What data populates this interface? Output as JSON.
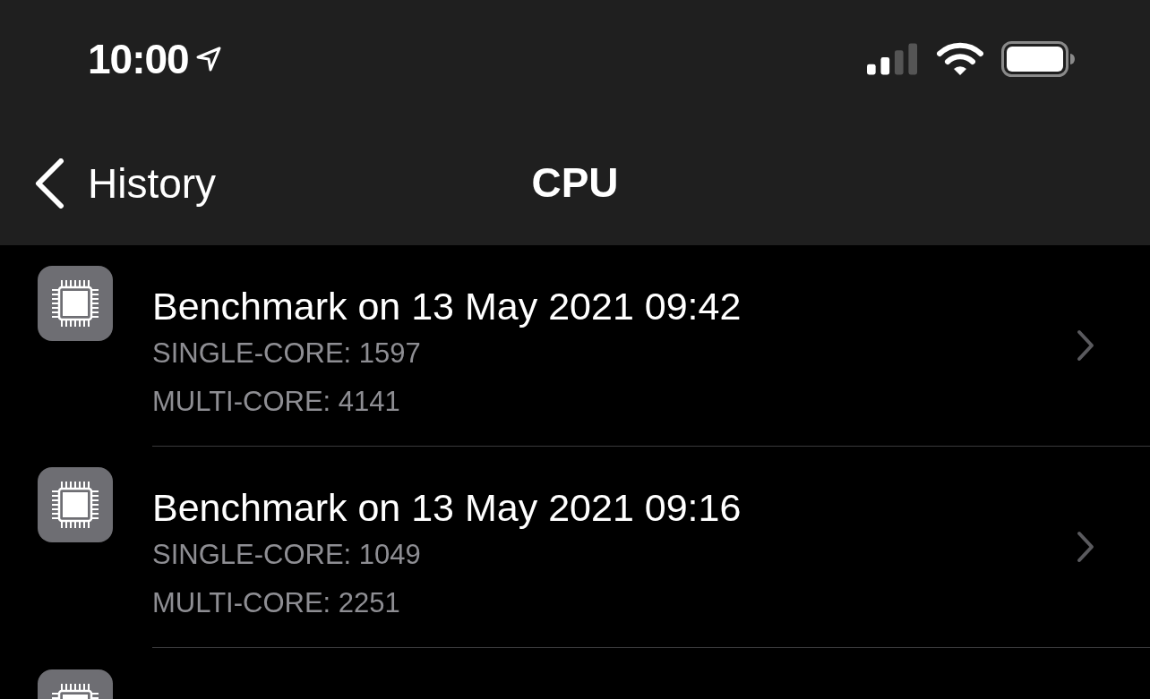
{
  "status_bar": {
    "time": "10:00"
  },
  "nav_bar": {
    "back_label": "History",
    "title": "CPU"
  },
  "results": [
    {
      "title": "Benchmark on 13 May 2021 09:42",
      "single_core": "SINGLE-CORE: 1597",
      "multi_core": "MULTI-CORE: 4141"
    },
    {
      "title": "Benchmark on 13 May 2021 09:16",
      "single_core": "SINGLE-CORE: 1049",
      "multi_core": "MULTI-CORE: 2251"
    }
  ]
}
